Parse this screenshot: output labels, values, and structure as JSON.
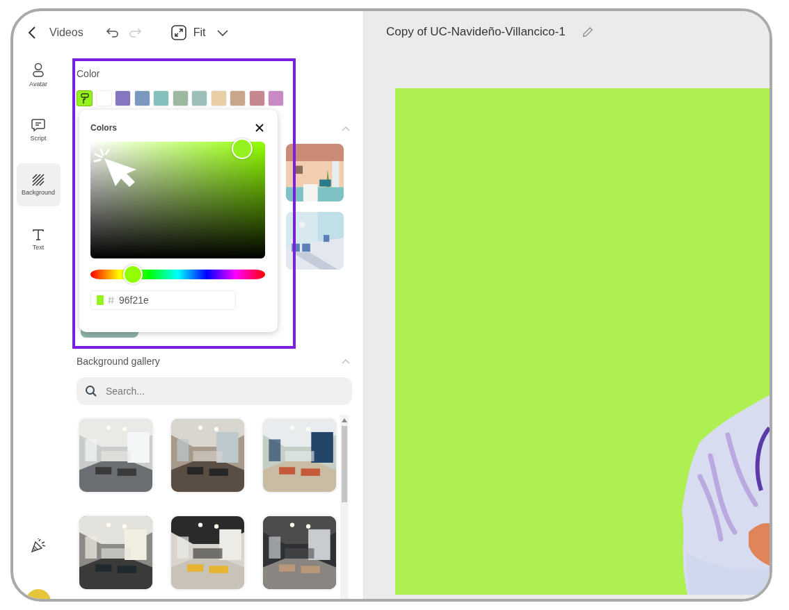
{
  "top_bar": {
    "back_label": "Videos",
    "undo": {
      "disabled": false
    },
    "redo": {
      "disabled": true
    },
    "zoom_label": "Fit"
  },
  "rail": [
    {
      "kind": "avatar",
      "label": "Avatar",
      "selected": false
    },
    {
      "kind": "script",
      "label": "Script",
      "selected": false
    },
    {
      "kind": "background",
      "label": "Background",
      "selected": true
    },
    {
      "kind": "text",
      "label": "Text",
      "selected": false
    }
  ],
  "color_section": {
    "title": "Color",
    "swatches": [
      {
        "kind": "picker",
        "color": "#96f21e",
        "selected": true
      },
      {
        "kind": "swatch",
        "color": "#ffffff",
        "selected": false
      },
      {
        "kind": "swatch",
        "color": "#8676c0",
        "selected": false
      },
      {
        "kind": "swatch",
        "color": "#7b98c0",
        "selected": false
      },
      {
        "kind": "swatch",
        "color": "#86c0bc",
        "selected": false
      },
      {
        "kind": "swatch",
        "color": "#9db89f",
        "selected": false
      },
      {
        "kind": "swatch",
        "color": "#9dbfba",
        "selected": false
      },
      {
        "kind": "swatch",
        "color": "#e9cfa6",
        "selected": false
      },
      {
        "kind": "swatch",
        "color": "#c9a58a",
        "selected": false
      },
      {
        "kind": "swatch",
        "color": "#c6868f",
        "selected": false
      },
      {
        "kind": "swatch",
        "color": "#c98ac4",
        "selected": false
      }
    ]
  },
  "section_2": {
    "expanded": true
  },
  "color_picker": {
    "title": "Colors",
    "hue": {
      "level": 0.24
    },
    "hex": "96f21e"
  },
  "gallery": {
    "title": "Background gallery",
    "expanded": true,
    "search": {
      "placeholder": "Search..."
    }
  },
  "canvas": {
    "title": "Copy of UC-Navideño-Villancico-1"
  }
}
